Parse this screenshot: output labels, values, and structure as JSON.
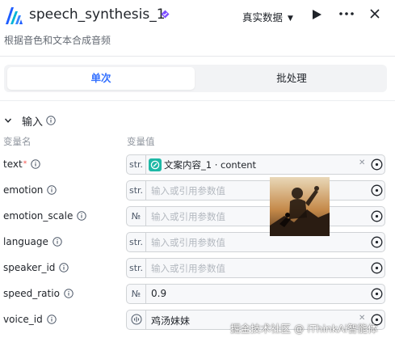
{
  "header": {
    "title": "speech_synthesis_1",
    "subtitle": "根据音色和文本合成音频",
    "mode_label": "真实数据",
    "icons": {
      "logo": "app-logo-icon",
      "verified": "verified-diamond-icon",
      "run": "play-icon",
      "more": "more-dots-icon",
      "close": "close-icon"
    },
    "accent": "#3370ff",
    "verified_color": "#7c4dff"
  },
  "tabs": [
    {
      "label": "单次",
      "active": true
    },
    {
      "label": "批处理",
      "active": false
    }
  ],
  "inputs_section": {
    "title": "输入",
    "col_name": "变量名",
    "col_value": "变量值",
    "rows": [
      {
        "name": "text",
        "required": "*",
        "type": "str.",
        "ref_label": "文案内容_1 · content"
      },
      {
        "name": "emotion",
        "type": "str.",
        "placeholder": "输入或引用参数值"
      },
      {
        "name": "emotion_scale",
        "type": "№",
        "placeholder": "输入或引用参数值"
      },
      {
        "name": "language",
        "type": "str.",
        "placeholder": "输入或引用参数值"
      },
      {
        "name": "speaker_id",
        "type": "str.",
        "placeholder": "输入或引用参数值"
      },
      {
        "name": "speed_ratio",
        "type": "№",
        "value": "0.9"
      },
      {
        "name": "voice_id",
        "type": "voice",
        "value": "鸡汤妹妹"
      }
    ]
  },
  "watermark": "掘金技术社区 @ iThinkAi智能体"
}
